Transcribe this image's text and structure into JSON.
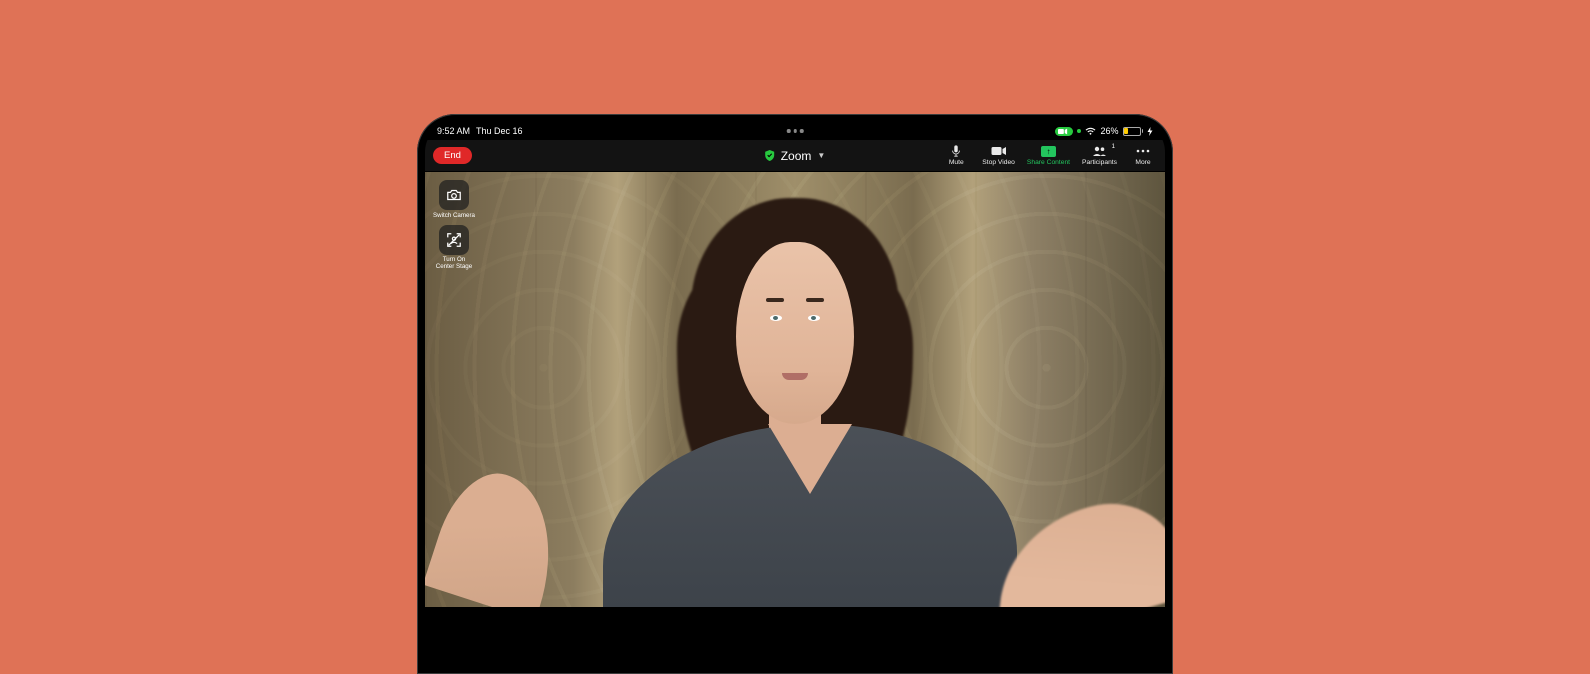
{
  "status": {
    "time": "9:52 AM",
    "date": "Thu Dec 16",
    "battery_pct": "26%"
  },
  "toolbar": {
    "end_label": "End",
    "app_title": "Zoom"
  },
  "controls": {
    "mute": "Mute",
    "stop_video": "Stop Video",
    "share_content": "Share Content",
    "participants": "Participants",
    "participants_count": "1",
    "more": "More"
  },
  "side": {
    "switch_camera": "Switch Camera",
    "center_stage_l1": "Turn On",
    "center_stage_l2": "Center Stage"
  }
}
